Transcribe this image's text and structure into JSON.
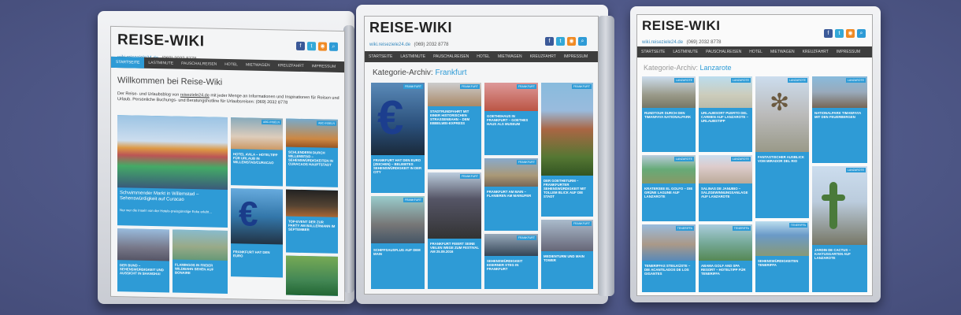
{
  "site": {
    "brand": "REISE-WIKI",
    "url": "wiki.reiseziele24.de",
    "phone": "(069) 2032 8778",
    "nav": [
      "STARTSEITE",
      "LASTMINUTE",
      "PAUSCHALREISEN",
      "HOTEL",
      "MIETWAGEN",
      "KREUZFAHRT",
      "IMPRESSUM"
    ],
    "social_icons": [
      "facebook-icon",
      "twitter-icon",
      "rss-icon",
      "search-icon"
    ]
  },
  "panel1": {
    "heading": "Willkommen bei Reise-Wiki",
    "intro_part1": "Der Reise- und Urlaubsblog von ",
    "intro_link": "reiseziele24.de",
    "intro_part2": " mit jeder Menge an Informationen und Inspirationen für Reisen und Urlaub. Persönliche Buchungs- und Beratungshotline für Urlaubsreisen: (069) 2032 8778",
    "big_caption": "Schwimmender Markt in Willemstad – Sehenswürdigkeit auf Curacao",
    "big_text": "Nur wer die Inseln von der Hotels-preisgünstige Ecke erlebt…",
    "tiles": [
      {
        "tag": "ABC-INSELN",
        "cap": "HOTEL AVILA – HOTELTIPP FÜR URLAUB IN WILLEMSTAD/CURACAO"
      },
      {
        "tag": "ABC-INSELN",
        "cap": "SCHLENDERN DURCH WILLEMSTAD – SEHENSWÜRDIGKEITEN IN CURACAOS HAUPTSTADT"
      },
      {
        "tag": "",
        "cap": "TOP-EVENT DER ZUR PARTY AM BALLERMANN IM SEPTEMBER"
      },
      {
        "tag": "",
        "cap": "DER BUND – SEHENSWÜRDIGKEIT UND AUSSICHT IN SHANGHAI"
      },
      {
        "tag": "",
        "cap": "FLAMINGOS IN FREIER WILDBAHN SEHEN AUF BONAIRE"
      },
      {
        "tag": "",
        "cap": "FRANKFURT HAT DEN EURO"
      }
    ]
  },
  "panel2": {
    "title_prefix": "Kategorie-Archiv: ",
    "title_cat": "Frankfurt",
    "tiles": [
      {
        "tag": "FRANKFURT",
        "cap": "FRANKFURT HAT DEN EURO (ZEICHEN) – BELIEBTES SEHENSWÜRDIGKEIT IN DER CITY"
      },
      {
        "tag": "FRANKFURT",
        "cap": "STADTRUNDFAHRT MIT EINER HISTORISCHEN STRASSENBAHN – DEM EBBELWEI-EXPRESS"
      },
      {
        "tag": "FRANKFURT",
        "cap": "GOETHEHAUS IN FRANKFURT – GOETHES HAUS ALS MUSEUM"
      },
      {
        "tag": "FRANKFURT",
        "cap": "DER GOETHETURM – FRANKFURTER SEHENSWÜRDIGKEIT MIT TOLLEM BLICK AUF DIE STADT"
      },
      {
        "tag": "FRANKFURT",
        "cap": "FRANKFURT AM MAIN – FLANIEREN AM MAINUFER"
      },
      {
        "tag": "FRANKFURT",
        "cap": "FRANKFURT FEIERT SEINE VIELEN WEGE ZUM FESTIVAL AM 25.09.2016"
      },
      {
        "tag": "FRANKFURT",
        "cap": "SCHIFFSAUSFLUG AUF DEM MAIN"
      },
      {
        "tag": "FRANKFURT",
        "cap": "SEHENSWÜRDIGKEIT EISERNER STEG IN FRANKFURT"
      },
      {
        "tag": "FRANKFURT",
        "cap": "MEDIENTURM UND MAIN TOWER"
      }
    ]
  },
  "panel3": {
    "title_prefix": "Kategorie-Archiv: ",
    "title_cat": "Lanzarote",
    "tiles": [
      {
        "tag": "LANZAROTE",
        "cap": "RUNDTOUR DURCH DEN TIMANFAYA NATIONALPARK"
      },
      {
        "tag": "LANZAROTE",
        "cap": "URLAUBSORT PUERTO DEL CARMEN AUF LANZAROTE – URLAUBSTIPP"
      },
      {
        "tag": "LANZAROTE",
        "cap": "FANTASTISCHER AUSBLICK VOM MIRADOR DEL RIO"
      },
      {
        "tag": "LANZAROTE",
        "cap": "NATIONALPARK TIMANFAYA MIT DEN FEUERBERGEN"
      },
      {
        "tag": "LANZAROTE",
        "cap": "KRATERSEE EL GOLFO – DIE GRÜNE LAGUNE AUF LANZAROTE"
      },
      {
        "tag": "LANZAROTE",
        "cap": "SALINAS DE JANUBIO – SALZGEWINNUNGSANLAGE AUF LANZAROTE"
      },
      {
        "tag": "TENERIFFA",
        "cap": "TENERIFFAS STEILKÜSTE – DIE ACANTILADOS DE LOS GIGANTES"
      },
      {
        "tag": "TENERIFFA",
        "cap": "ABAMA GOLF AND SPA RESORT – HOTELTIPP FÜR TENERIFFA"
      },
      {
        "tag": "TENERIFFA",
        "cap": "SEHENSWÜRDIGKEITEN TENERIFFA"
      },
      {
        "tag": "LANZAROTE",
        "cap": "JARDIN DE CACTUS – KAKTUSGARTEN AUF LANZAROTE"
      }
    ]
  }
}
